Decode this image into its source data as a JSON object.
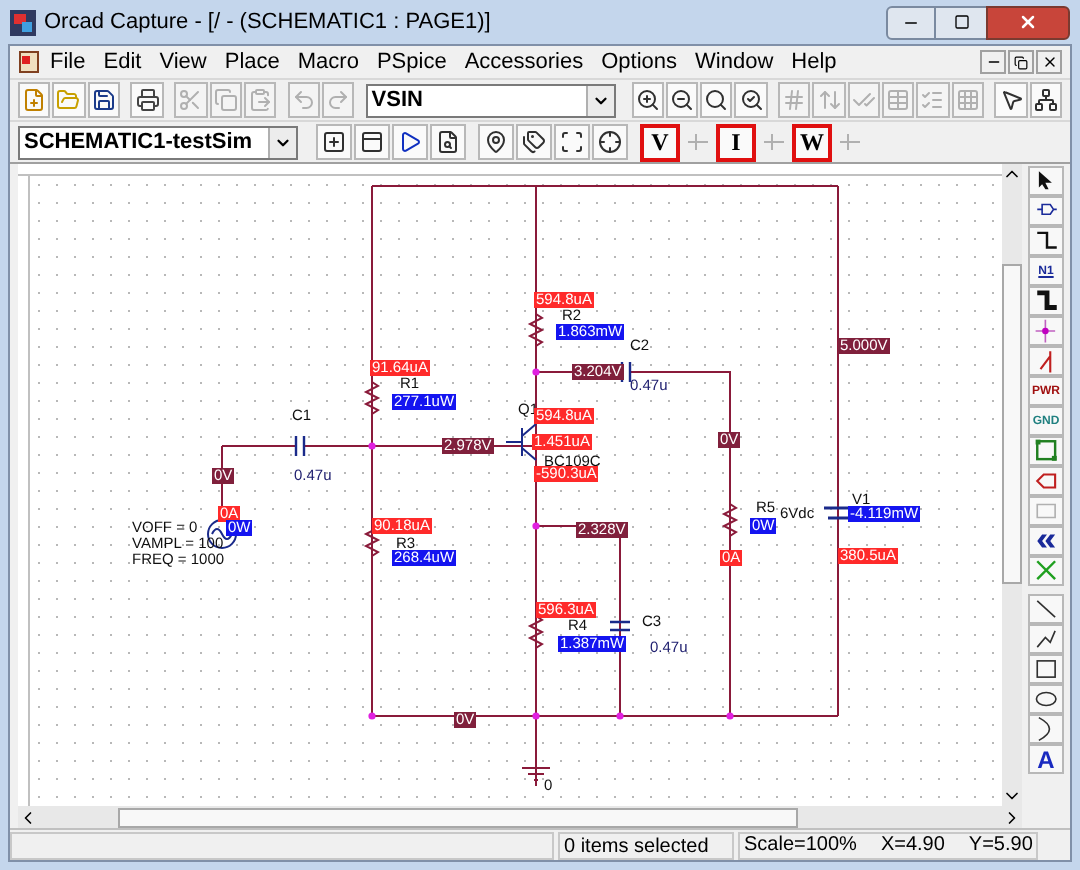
{
  "window": {
    "title": "Orcad Capture - [/ - (SCHEMATIC1 : PAGE1)]"
  },
  "menu": [
    "File",
    "Edit",
    "View",
    "Place",
    "Macro",
    "PSpice",
    "Accessories",
    "Options",
    "Window",
    "Help"
  ],
  "toolbar": {
    "tools_left": [
      {
        "kind": "new",
        "disabled": false
      },
      {
        "kind": "open",
        "disabled": false
      },
      {
        "kind": "save",
        "disabled": false
      },
      {
        "kind": "print",
        "disabled": false
      },
      {
        "kind": "cut",
        "disabled": true
      },
      {
        "kind": "copy",
        "disabled": true
      },
      {
        "kind": "paste",
        "disabled": true
      },
      {
        "kind": "undo",
        "disabled": true
      },
      {
        "kind": "redo",
        "disabled": true
      }
    ],
    "part_combo": "VSIN",
    "tools_right": [
      {
        "kind": "zoom-in",
        "disabled": false
      },
      {
        "kind": "zoom-out",
        "disabled": false
      },
      {
        "kind": "zoom-area",
        "disabled": false
      },
      {
        "kind": "zoom-all",
        "disabled": false
      },
      {
        "kind": "annotate",
        "disabled": true
      },
      {
        "kind": "back-annotate",
        "disabled": true
      },
      {
        "kind": "drc",
        "disabled": true
      },
      {
        "kind": "netlist",
        "disabled": true
      },
      {
        "kind": "cross-ref",
        "disabled": true
      },
      {
        "kind": "bom",
        "disabled": true
      },
      {
        "kind": "pointer",
        "disabled": false
      },
      {
        "kind": "project",
        "disabled": false
      }
    ]
  },
  "sim_toolbar": {
    "profile_combo": "SCHEMATIC1-testSim",
    "tools": [
      {
        "kind": "new-profile",
        "disabled": false
      },
      {
        "kind": "edit-profile",
        "disabled": false
      },
      {
        "kind": "run",
        "disabled": false
      },
      {
        "kind": "view-results",
        "disabled": false
      },
      {
        "kind": "voltage-marker",
        "disabled": false
      },
      {
        "kind": "current-marker",
        "disabled": false
      },
      {
        "kind": "power-marker",
        "disabled": false
      },
      {
        "kind": "diff-marker",
        "disabled": false
      }
    ],
    "bias": [
      {
        "label": "V",
        "selected": true
      },
      {
        "selected": false
      },
      {
        "label": "I",
        "selected": true
      },
      {
        "selected": false
      },
      {
        "label": "W",
        "selected": true
      },
      {
        "selected": false
      }
    ]
  },
  "schematic": {
    "labels": [
      {
        "kind": "current",
        "text": "594.8uA"
      },
      {
        "kind": "name",
        "text": "R2"
      },
      {
        "kind": "power",
        "text": "1.863mW"
      },
      {
        "kind": "name",
        "text": "C2"
      },
      {
        "kind": "voltage",
        "text": "3.204V"
      },
      {
        "kind": "value",
        "text": "0.47u"
      },
      {
        "kind": "voltage",
        "text": "5.000V"
      },
      {
        "kind": "current",
        "text": "91.64uA"
      },
      {
        "kind": "name",
        "text": "R1"
      },
      {
        "kind": "power",
        "text": "277.1uW"
      },
      {
        "kind": "name",
        "text": "C1"
      },
      {
        "kind": "name",
        "text": "Q1"
      },
      {
        "kind": "current",
        "text": "594.8uA"
      },
      {
        "kind": "voltage",
        "text": "2.978V"
      },
      {
        "kind": "current",
        "text": "1.451uA"
      },
      {
        "kind": "name",
        "text": "BC109C"
      },
      {
        "kind": "voltage",
        "text": "0V"
      },
      {
        "kind": "value",
        "text": "0.47u"
      },
      {
        "kind": "current",
        "text": "-590.3uA"
      },
      {
        "kind": "voltage",
        "text": "0V"
      },
      {
        "kind": "current",
        "text": "0A"
      },
      {
        "kind": "name",
        "text": "VOFF = 0"
      },
      {
        "kind": "power",
        "text": "0W"
      },
      {
        "kind": "name",
        "text": "VAMPL = 100"
      },
      {
        "kind": "name",
        "text": "FREQ = 1000"
      },
      {
        "kind": "current",
        "text": "90.18uA"
      },
      {
        "kind": "name",
        "text": "R3"
      },
      {
        "kind": "power",
        "text": "268.4uW"
      },
      {
        "kind": "voltage",
        "text": "2.328V"
      },
      {
        "kind": "name",
        "text": "R5"
      },
      {
        "kind": "power",
        "text": "0W"
      },
      {
        "kind": "name",
        "text": "6Vdc"
      },
      {
        "kind": "name",
        "text": "V1"
      },
      {
        "kind": "power",
        "text": "-4.119mW"
      },
      {
        "kind": "current",
        "text": "0A"
      },
      {
        "kind": "current",
        "text": "380.5uA"
      },
      {
        "kind": "current",
        "text": "596.3uA"
      },
      {
        "kind": "name",
        "text": "R4"
      },
      {
        "kind": "power",
        "text": "1.387mW"
      },
      {
        "kind": "name",
        "text": "C3"
      },
      {
        "kind": "value",
        "text": "0.47u"
      },
      {
        "kind": "voltage",
        "text": "0V"
      },
      {
        "kind": "name",
        "text": "0"
      }
    ]
  },
  "palette": [
    {
      "kind": "select"
    },
    {
      "kind": "part"
    },
    {
      "kind": "wire"
    },
    {
      "kind": "net-alias",
      "label": "N1"
    },
    {
      "kind": "bus"
    },
    {
      "kind": "junction"
    },
    {
      "kind": "bus-entry"
    },
    {
      "kind": "power",
      "label": "PWR"
    },
    {
      "kind": "ground",
      "label": "GND"
    },
    {
      "kind": "hier-block"
    },
    {
      "kind": "port"
    },
    {
      "kind": "hier-pin"
    },
    {
      "kind": "off-page"
    },
    {
      "kind": "no-connect"
    },
    {
      "kind": "line"
    },
    {
      "kind": "polyline"
    },
    {
      "kind": "rectangle"
    },
    {
      "kind": "ellipse"
    },
    {
      "kind": "arc"
    },
    {
      "kind": "text",
      "label": "A"
    }
  ],
  "status_bar": {
    "selection": "0 items selected",
    "scale": "Scale=100%",
    "x": "X=4.90",
    "y": "Y=5.90"
  }
}
